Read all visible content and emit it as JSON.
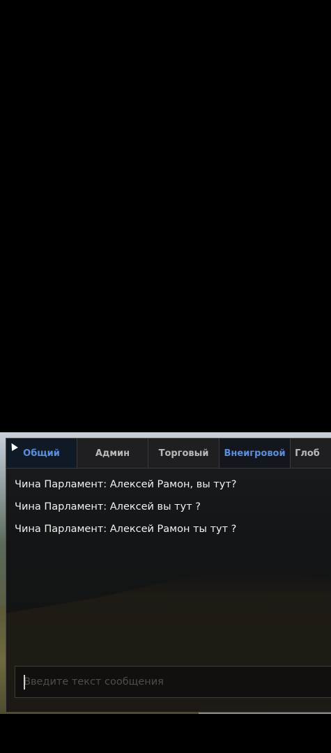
{
  "tabs": [
    {
      "label": "Общий"
    },
    {
      "label": "Админ"
    },
    {
      "label": "Торговый"
    },
    {
      "label": "Внеигровой"
    },
    {
      "label": "Глоб"
    }
  ],
  "messages": [
    {
      "text": "Чина Парламент: Алексей Рамон, вы тут?"
    },
    {
      "text": "Чина Парламент: Алексей вы тут ?"
    },
    {
      "text": "Чина Парламент: Алексей Рамон ты тут ?"
    }
  ],
  "input": {
    "placeholder": "Введите текст сообщения",
    "value": ""
  },
  "colors": {
    "active_tab_text": "#5b8fdd",
    "panel_bg": "#0e0e10"
  }
}
